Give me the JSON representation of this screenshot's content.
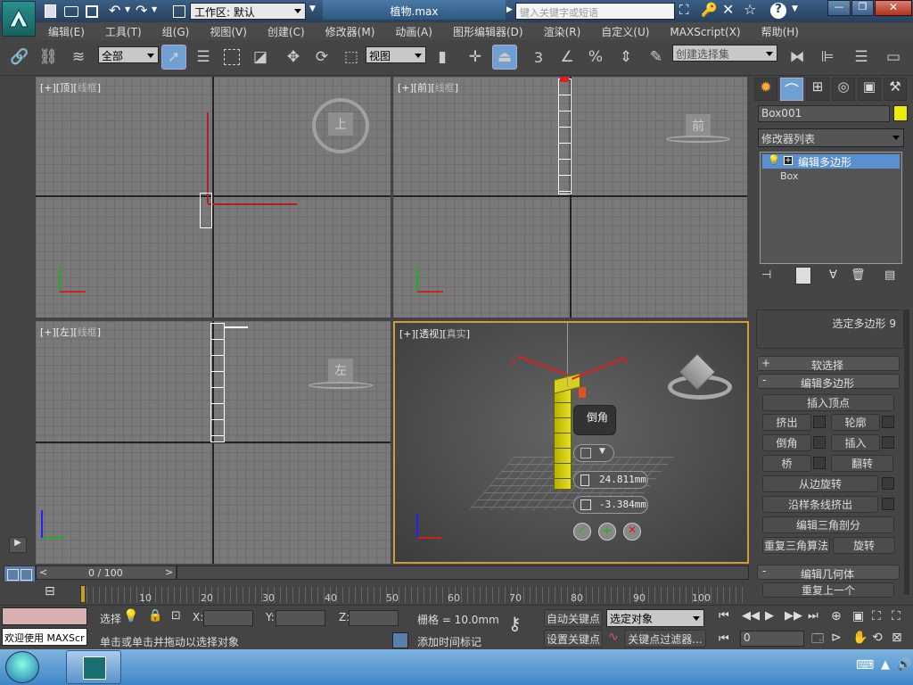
{
  "titlebar": {
    "workspace_label": "工作区: 默认",
    "filename": "植物.max",
    "search_placeholder": "键入关键字或短语"
  },
  "menu": [
    "编辑(E)",
    "工具(T)",
    "组(G)",
    "视图(V)",
    "创建(C)",
    "修改器(M)",
    "动画(A)",
    "图形编辑器(D)",
    "渲染(R)",
    "自定义(U)",
    "MAXScript(X)",
    "帮助(H)"
  ],
  "toolbar": {
    "filter_select": "全部",
    "ref_coord_select": "视图",
    "snap_number": "3",
    "named_selection_placeholder": "创建选择集"
  },
  "viewports": {
    "top": {
      "name": "顶",
      "mode": "线框",
      "cube_label": "上"
    },
    "front": {
      "name": "前",
      "mode": "线框",
      "cube_label": "前"
    },
    "left": {
      "name": "左",
      "mode": "线框",
      "cube_label": "左"
    },
    "persp": {
      "name": "透视",
      "mode": "真实"
    }
  },
  "caddy": {
    "title": "倒角",
    "height_value": "24.811mm",
    "outline_value": "-3.384mm"
  },
  "cmdpanel": {
    "object_name": "Box001",
    "modifier_list": "修改器列表",
    "stack": [
      "编辑多边形",
      "Box"
    ],
    "selection_info": "选定多边形 9",
    "soft_selection": "软选择",
    "edit_polygons": "编辑多边形",
    "insert_vertex": "插入顶点",
    "extrude": "挤出",
    "outline": "轮廓",
    "bevel": "倒角",
    "inset": "插入",
    "bridge": "桥",
    "flip": "翻转",
    "hinge_from_edge": "从边旋转",
    "extrude_along_spline": "沿样条线挤出",
    "edit_triangulation": "编辑三角剖分",
    "retriangulate": "重复三角算法",
    "turn": "旋转",
    "edit_geometry": "编辑几何体",
    "repeat_last": "重复上一个"
  },
  "timeline": {
    "slider_text": "0 / 100",
    "ticks": [
      "10",
      "20",
      "30",
      "40",
      "50",
      "60",
      "70",
      "80",
      "90",
      "100"
    ]
  },
  "status": {
    "welcome": "欢迎使用 MAXScr",
    "select_label": "选择",
    "x_label": "X:",
    "y_label": "Y:",
    "z_label": "Z:",
    "grid": "栅格 = 10.0mm",
    "prompt": "单击或单击并拖动以选择对象",
    "add_time_tag": "添加时间标记",
    "auto_key": "自动关键点",
    "set_key": "设置关键点",
    "selected_object": "选定对象",
    "key_filters": "关键点过滤器...",
    "frame": "0"
  }
}
